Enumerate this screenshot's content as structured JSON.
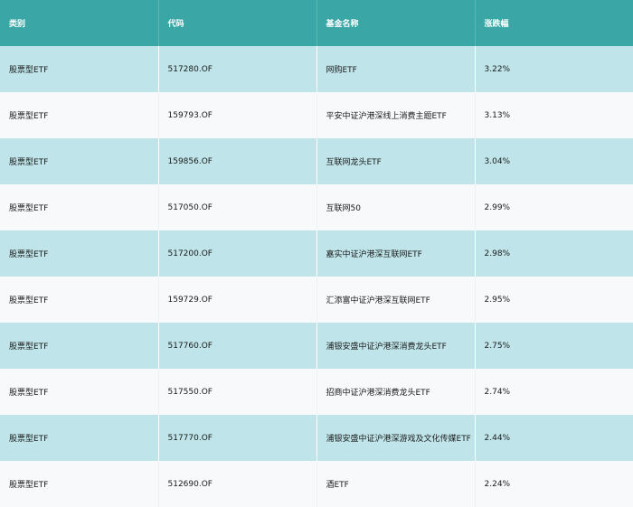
{
  "headers": [
    "类别",
    "代码",
    "基金名称",
    "涨跌幅"
  ],
  "rows": [
    [
      "股票型ETF",
      "517280.OF",
      "网购ETF",
      "3.22%"
    ],
    [
      "股票型ETF",
      "159793.OF",
      "平安中证沪港深线上消费主题ETF",
      "3.13%"
    ],
    [
      "股票型ETF",
      "159856.OF",
      "互联网龙头ETF",
      "3.04%"
    ],
    [
      "股票型ETF",
      "517050.OF",
      "互联网50",
      "2.99%"
    ],
    [
      "股票型ETF",
      "517200.OF",
      "嘉实中证沪港深互联网ETF",
      "2.98%"
    ],
    [
      "股票型ETF",
      "159729.OF",
      "汇添富中证沪港深互联网ETF",
      "2.95%"
    ],
    [
      "股票型ETF",
      "517760.OF",
      "浦银安盛中证沪港深消费龙头ETF",
      "2.75%"
    ],
    [
      "股票型ETF",
      "517550.OF",
      "招商中证沪港深消费龙头ETF",
      "2.74%"
    ],
    [
      "股票型ETF",
      "517770.OF",
      "浦银安盛中证沪港深游戏及文化传媒ETF",
      "2.44%"
    ],
    [
      "股票型ETF",
      "512690.OF",
      "酒ETF",
      "2.24%"
    ]
  ]
}
